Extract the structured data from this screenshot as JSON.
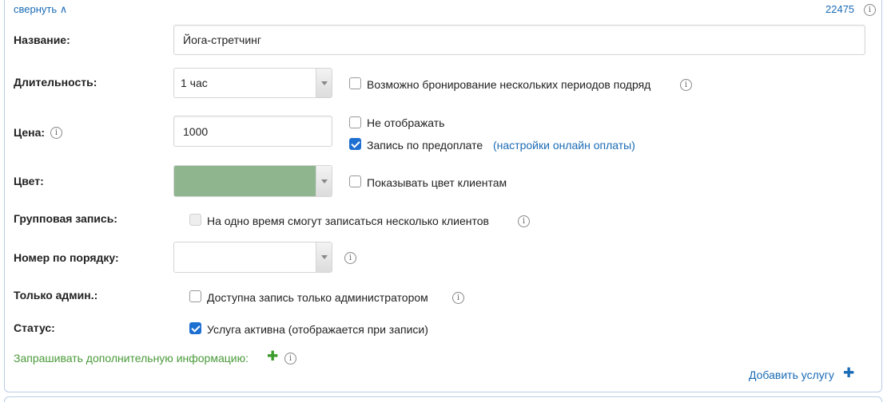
{
  "header": {
    "collapse_label": "свернуть ∧",
    "service_id": "22475"
  },
  "fields": {
    "name": {
      "label": "Название:",
      "value": "Йога-стретчинг"
    },
    "duration": {
      "label": "Длительность:",
      "value": "1 час",
      "multi_label": "Возможно бронирование нескольких периодов подряд",
      "multi_checked": false
    },
    "price": {
      "label": "Цена:",
      "value": "1000",
      "hide_label": "Не отображать",
      "hide_checked": false,
      "prepay_label": "Запись по предоплате",
      "prepay_checked": true,
      "prepay_link": "(настройки онлайн оплаты)"
    },
    "color": {
      "label": "Цвет:",
      "value": "#8fb58f",
      "show_label": "Показывать цвет клиентам",
      "show_checked": false
    },
    "group": {
      "label": "Групповая запись:",
      "option_label": "На одно время смогут записаться несколько клиентов",
      "checked": false,
      "disabled": true
    },
    "order": {
      "label": "Номер по порядку:",
      "value": ""
    },
    "admin_only": {
      "label": "Только админ.:",
      "option_label": "Доступна запись только администратором",
      "checked": false
    },
    "status": {
      "label": "Статус:",
      "option_label": "Услуга активна (отображается при записи)",
      "checked": true
    }
  },
  "extra_info": {
    "label": "Запрашивать дополнительную информацию:"
  },
  "add_service": {
    "label": "Добавить услугу"
  },
  "icons": {
    "info": "info-icon",
    "plus": "plus-icon",
    "checkbox": "checkbox",
    "dropdown": "chevron-down-icon"
  },
  "colors": {
    "link": "#1a6bb5",
    "green": "#4a9a3a",
    "check": "#1d6fd1",
    "border": "#b8cde4"
  }
}
